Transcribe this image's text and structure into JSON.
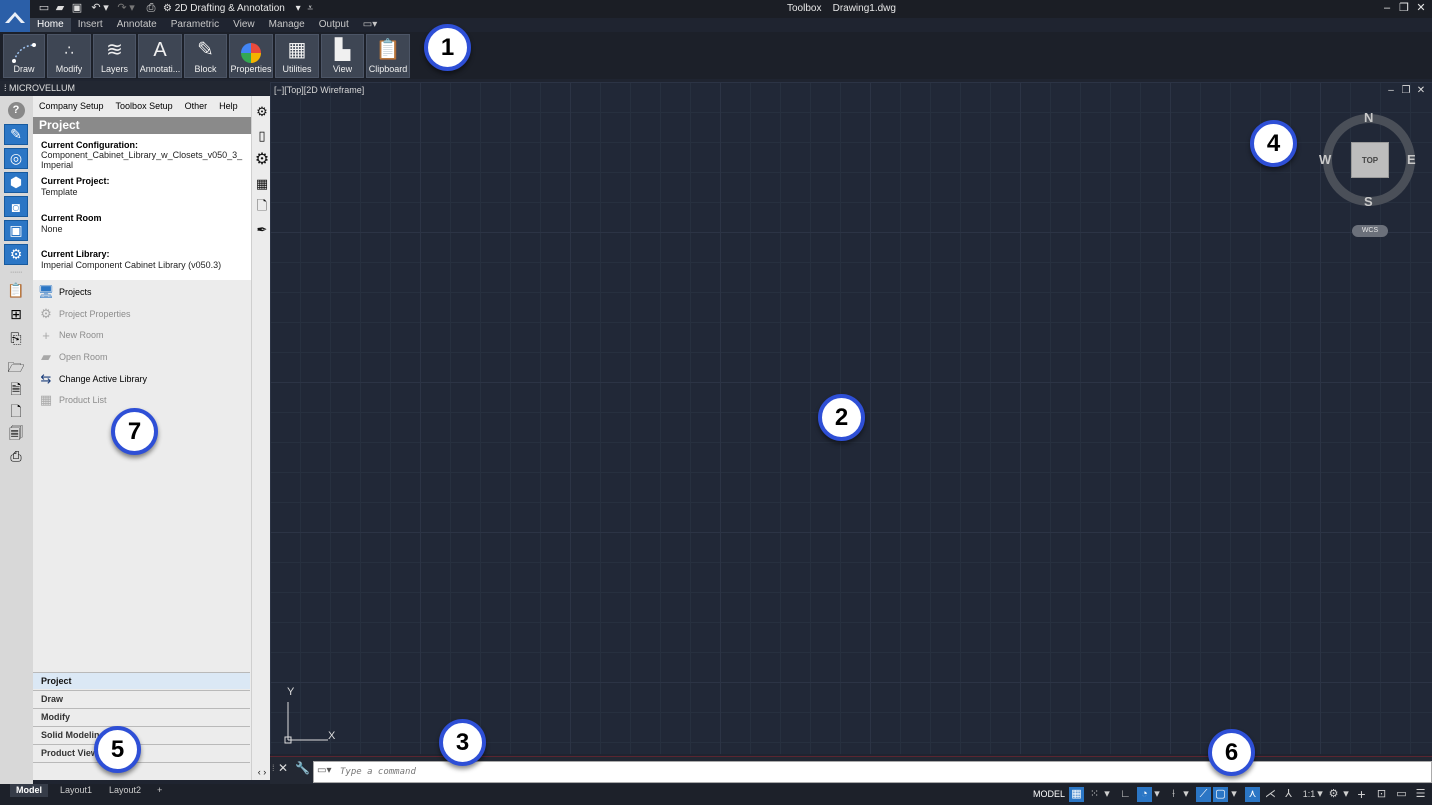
{
  "title_bar": {
    "app_title": "Toolbox",
    "file_name": "Drawing1.dwg",
    "workspace": "2D Drafting & Annotation"
  },
  "ribbon": {
    "tabs": [
      "Home",
      "Insert",
      "Annotate",
      "Parametric",
      "View",
      "Manage",
      "Output"
    ],
    "active_tab": "Home",
    "buttons": [
      {
        "label": "Draw",
        "icon": "draw-arc-icon"
      },
      {
        "label": "Modify",
        "icon": "modify-icon"
      },
      {
        "label": "Layers",
        "icon": "layers-icon"
      },
      {
        "label": "Annotati...",
        "icon": "text-annotation-icon"
      },
      {
        "label": "Block",
        "icon": "block-icon"
      },
      {
        "label": "Properties",
        "icon": "color-wheel-icon"
      },
      {
        "label": "Utilities",
        "icon": "calculator-icon"
      },
      {
        "label": "View",
        "icon": "view-icon"
      },
      {
        "label": "Clipboard",
        "icon": "clipboard-icon"
      }
    ]
  },
  "palette": {
    "header": "MICROVELLUM",
    "menu": [
      "Company Setup",
      "Toolbox Setup",
      "Other",
      "Help"
    ],
    "section_title": "Project",
    "info": {
      "config_label": "Current Configuration:",
      "config_value": "Component_Cabinet_Library_w_Closets_v050_3_ Imperial",
      "project_label": "Current Project:",
      "project_value": "Template",
      "room_label": "Current Room",
      "room_value": "None",
      "library_label": "Current Library:",
      "library_value": "Imperial Component Cabinet Library (v050.3)"
    },
    "actions": [
      {
        "label": "Projects",
        "enabled": true
      },
      {
        "label": "Project Properties",
        "enabled": false
      },
      {
        "label": "New Room",
        "enabled": false
      },
      {
        "label": "Open Room",
        "enabled": false
      },
      {
        "label": "Change Active Library",
        "enabled": true
      },
      {
        "label": "Product List",
        "enabled": false
      }
    ],
    "section_tabs": [
      "Project",
      "Draw",
      "Modify",
      "Solid Modeling",
      "Product View"
    ],
    "active_section_tab": "Project"
  },
  "viewport": {
    "label": "[−][Top][2D Wireframe]",
    "viewcube": {
      "face": "TOP",
      "north": "N",
      "south": "S",
      "east": "E",
      "west": "W",
      "ucs": "WCS"
    },
    "ucs_axes": {
      "x": "X",
      "y": "Y"
    }
  },
  "command_line": {
    "placeholder": "Type a command"
  },
  "status_bar": {
    "layout_tabs": [
      "Model",
      "Layout1",
      "Layout2"
    ],
    "active_layout": "Model",
    "model_label": "MODEL",
    "scale": "1:1"
  },
  "callouts": [
    "1",
    "2",
    "3",
    "4",
    "5",
    "6",
    "7"
  ],
  "colors": {
    "accent_blue": "#2b76c5",
    "callout_border": "#2e4fd6",
    "viewport_bg": "#212837"
  }
}
